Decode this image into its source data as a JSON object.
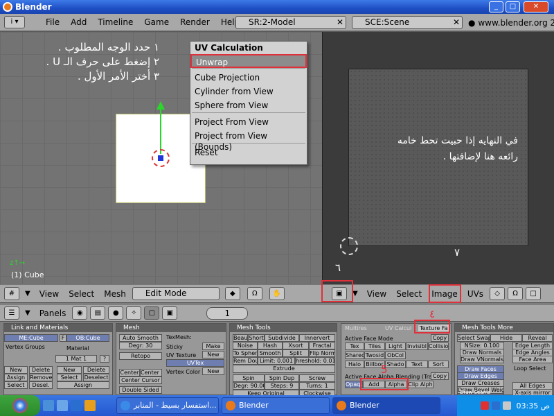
{
  "window": {
    "title": "Blender"
  },
  "menubar": {
    "items": [
      "File",
      "Add",
      "Timeline",
      "Game",
      "Render",
      "Help"
    ],
    "screen_combo": "SR:2-Model",
    "scene_combo": "SCE:Scene",
    "website": "www.blender.org 2"
  },
  "view3d": {
    "instructions": [
      "١ حدد الوجه المطلوب .",
      "٢ إضغط على حرف الـ U .",
      "٣ أختر الأمر الأول ."
    ],
    "object_info": "(1) Cube"
  },
  "uv_popup": {
    "title": "UV Calculation",
    "items": [
      "Unwrap",
      "Cube Projection",
      "Cylinder from View",
      "Sphere from View",
      "Project From View",
      "Project from View (Bounds)",
      "Reset"
    ]
  },
  "uv_view": {
    "note": [
      "في النهايه إذا حبيت تحط خامه",
      "رائعه هنا لإضافتها ."
    ],
    "numbers": [
      "٦",
      "٧",
      "٤",
      "5"
    ]
  },
  "header3d": {
    "items": [
      "View",
      "Select",
      "Mesh"
    ],
    "mode": "Edit Mode"
  },
  "header_uv": {
    "items": [
      "View",
      "Select",
      "Image",
      "UVs"
    ]
  },
  "buttons_header": {
    "label": "Panels",
    "page": "1"
  },
  "panels": {
    "link": {
      "title": "Link and Materials",
      "me": "ME:Cube",
      "f": "F",
      "ob": "OB:Cube",
      "vg": "Vertex Groups",
      "mat": "Material",
      "mat1": "1 Mat 1",
      "q": "?",
      "new": "New",
      "delete": "Delete",
      "assign": "Assign",
      "remove": "Remove",
      "select": "Select",
      "desel": "Desel.",
      "new2": "New",
      "delete2": "Delete",
      "select2": "Select",
      "deselect2": "Deselect",
      "assign2": "Assign"
    },
    "mesh": {
      "title": "Mesh",
      "autosmooth": "Auto Smooth",
      "degr": "Degr: 30",
      "retopo": "Retopo",
      "texmesh": "TexMesh:",
      "sticky": "Sticky",
      "make": "Make",
      "uvtex": "UV Texture",
      "new": "New",
      "uvtexv": "UVTex",
      "vcol": "Vertex Color",
      "new2": "New",
      "cc1": "Center",
      "cc2": "Center Ne",
      "cc3": "Center Cursor",
      "ds": "Double Sided"
    },
    "tools": {
      "title": "Mesh Tools",
      "r1": [
        "Beaut",
        "Short",
        "Subdivide",
        "Innervert"
      ],
      "r2": [
        "Noise",
        "Hash",
        "Xsort",
        "Fractal"
      ],
      "r3": [
        "To Spher",
        "Smooth",
        "Split",
        "Flip Norm"
      ],
      "r4": [
        "Rem Dou",
        "Limit: 0.001",
        "hreshold: 0.010"
      ],
      "extrude": "Extrude",
      "r5": [
        "Spin",
        "Spin Dup",
        "Screw"
      ],
      "r6": [
        "Degr: 90.00",
        "Steps: 9",
        "Turns: 1"
      ],
      "r7": [
        "Keep Original",
        "Clockwise"
      ]
    },
    "multires": {
      "tabs": [
        "Multires",
        "UV Calcul",
        "Texture Fa"
      ],
      "afm": "Active Face Mode",
      "copy": "Copy",
      "r1": [
        "Tex",
        "Tiles",
        "Light",
        "Invisibl",
        "Collisio"
      ],
      "r2": [
        "Shared",
        "Twosid",
        "ObCol"
      ],
      "r3": [
        "Halo",
        "Billbor",
        "Shado",
        "Text",
        "Sort"
      ],
      "blend": "Active Face Alpha Blending (Tran",
      "copy2": "Copy",
      "r4": [
        "Opaque",
        "Add",
        "Alpha",
        "Clip Alph"
      ]
    },
    "tools_more": {
      "title": "Mesh Tools More",
      "r1": [
        "Select Swap",
        "Hide",
        "Reveal"
      ],
      "nsize": "NSize: 0.100",
      "edgelen": "Edge Length",
      "drawn": "Draw Normals",
      "edgeang": "Edge Angles",
      "drawvn": "Draw VNormals",
      "facearea": "Face Area",
      "loopsel": "Loop Select",
      "drawfaces": "Draw Faces",
      "drawedges": "Draw Edges",
      "drawcreases": "Draw Creases",
      "drawbevel": "Draw Bevel Weigh",
      "drawseams": "Draw Seams",
      "alledges": "All Edges",
      "xmirror": "X-axis mirror"
    }
  },
  "taskbar": {
    "t1": "استفسار بسيط - المنابر...",
    "t2": "Blender",
    "t3": "Blender",
    "clock": "ص 03:35"
  },
  "colors": {
    "highlight": "#e0303a",
    "accent": "#2bd62b"
  }
}
